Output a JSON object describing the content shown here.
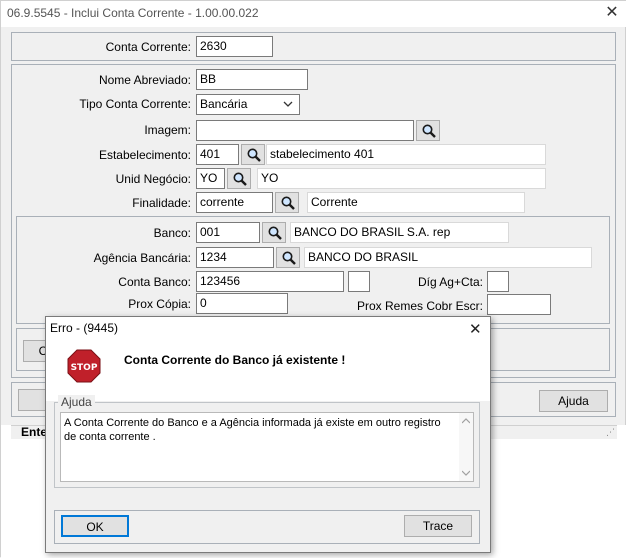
{
  "window": {
    "title": "06.9.5545 - Inclui Conta Corrente - 1.00.00.022",
    "close_glyph": "✕"
  },
  "form": {
    "conta_corrente": {
      "label": "Conta Corrente:",
      "value": "2630"
    },
    "nome_abreviado": {
      "label": "Nome Abreviado:",
      "value": "BB"
    },
    "tipo_conta": {
      "label": "Tipo Conta Corrente:",
      "value": "Bancária"
    },
    "imagem": {
      "label": "Imagem:",
      "value": ""
    },
    "estabelecimento": {
      "label": "Estabelecimento:",
      "value": "401",
      "desc": "stabelecimento 401"
    },
    "unid_negocio": {
      "label": "Unid Negócio:",
      "value": "YO",
      "desc": "YO"
    },
    "finalidade": {
      "label": "Finalidade:",
      "value": "corrente",
      "desc": "Corrente"
    },
    "banco": {
      "label": "Banco:",
      "value": "001",
      "desc": "BANCO DO BRASIL S.A. rep"
    },
    "agencia": {
      "label": "Agência Bancária:",
      "value": "1234",
      "desc": "BANCO DO BRASIL"
    },
    "conta_banco": {
      "label": "Conta Banco:",
      "value": "123456",
      "dig": ""
    },
    "dig_ag_cta": {
      "label": "Díg Ag+Cta:",
      "value": ""
    },
    "prox_copia": {
      "label": "Prox Cópia:",
      "value": "0"
    },
    "prox_remes": {
      "label": "Prox Remes Cobr Escr:",
      "value": ""
    }
  },
  "bottom": {
    "partial_button_letter": "C",
    "ajuda_button": "Ajuda",
    "status_partial": "Ente"
  },
  "dialog": {
    "title": "Erro - (9445)",
    "close_glyph": "✕",
    "stop_text": "STOP",
    "message": "Conta Corrente do Banco já existente !",
    "help_legend": "Ajuda",
    "help_text": "A Conta Corrente do Banco e a Agência informada já existe em outro registro de conta corrente .",
    "ok_button": "OK",
    "trace_button": "Trace"
  },
  "colors": {
    "stop_red": "#c0202a",
    "button_bg": "#e1e1e1",
    "focus_border": "#0078d7"
  }
}
